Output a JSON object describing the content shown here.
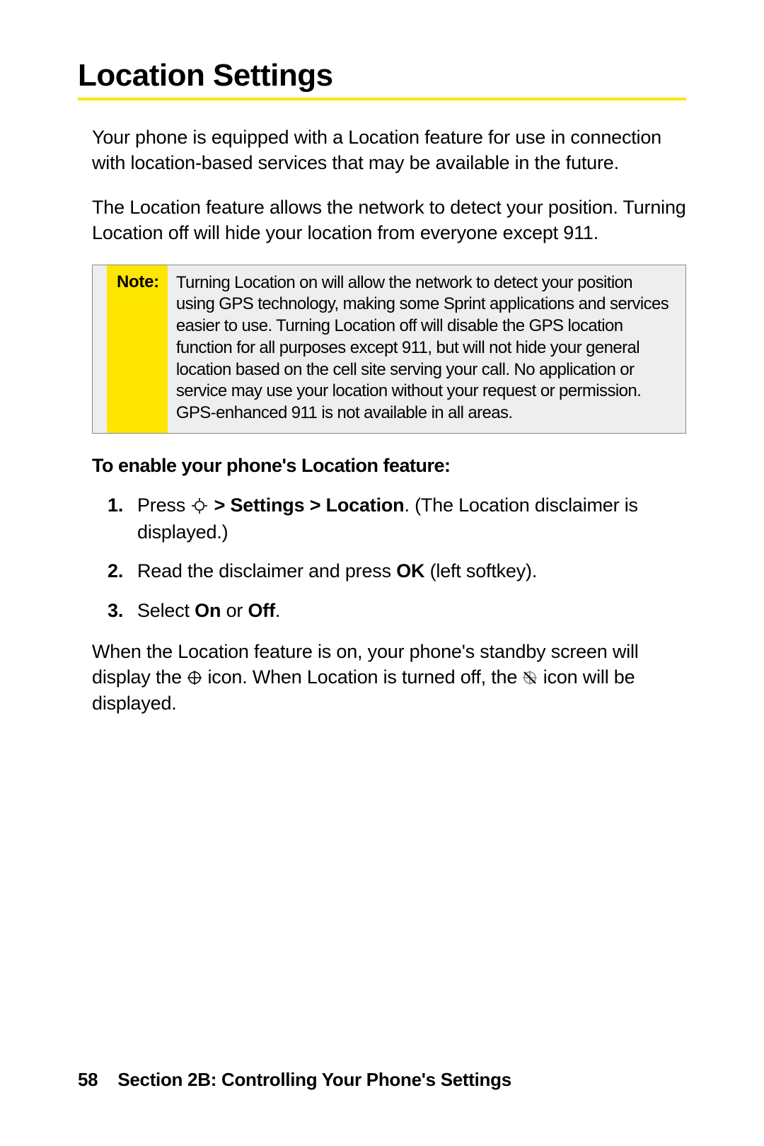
{
  "title": "Location Settings",
  "para1": "Your phone is equipped with a Location feature for use in connection with location-based services that may be available in the future.",
  "para2": "The Location feature allows the network to detect your position. Turning Location off will hide your location from everyone except 911.",
  "note": {
    "label": "Note:",
    "text": "Turning Location on will allow the network to detect your position using GPS technology, making some Sprint applications and services easier to use. Turning Location off will disable the GPS location function for all purposes except 911, but will not hide your general location based on the cell site serving your call. No application or service may use your location without your request or permission. GPS-enhanced 911 is not available in all areas."
  },
  "subhead": "To enable your phone's Location feature:",
  "steps": {
    "s1": {
      "num": "1.",
      "a": "Press ",
      "b": " > Settings > Location",
      "c": ". (The Location disclaimer is displayed.)"
    },
    "s2": {
      "num": "2.",
      "a": "Read the disclaimer and press ",
      "b": "OK",
      "c": " (left softkey)."
    },
    "s3": {
      "num": "3.",
      "a": "Select ",
      "b": "On",
      "c": " or ",
      "d": "Off",
      "e": "."
    }
  },
  "closing": {
    "a": "When the Location feature is on, your phone's standby screen will display the ",
    "b": " icon. When Location is turned off, the ",
    "c": " icon will be displayed."
  },
  "footer": {
    "page": "58",
    "section": "Section 2B: Controlling Your Phone's Settings"
  }
}
